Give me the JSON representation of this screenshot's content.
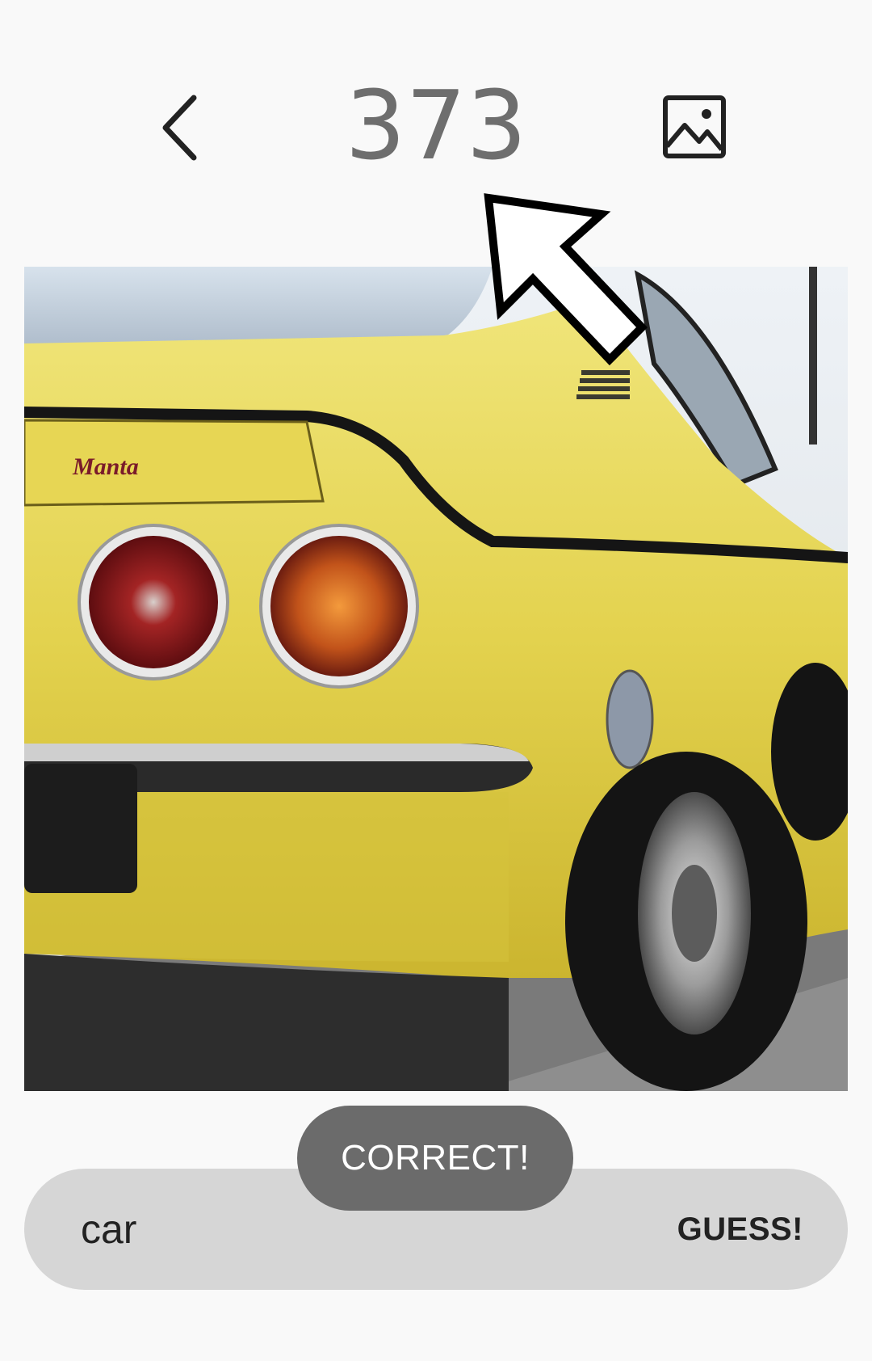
{
  "header": {
    "score": "373",
    "back_icon": "chevron-left-icon",
    "image_icon": "image-icon"
  },
  "photo": {
    "subject": "yellow car",
    "emblem_text": "Manta"
  },
  "guess": {
    "input_value": "car",
    "button_label": "GUESS!"
  },
  "toast": {
    "message": "CORRECT!"
  },
  "colors": {
    "background": "#f9f9f9",
    "score_text": "#6e6e6e",
    "guess_bar": "#d6d6d6",
    "toast_bg": "#6b6b6b",
    "car_yellow": "#e8d850"
  }
}
